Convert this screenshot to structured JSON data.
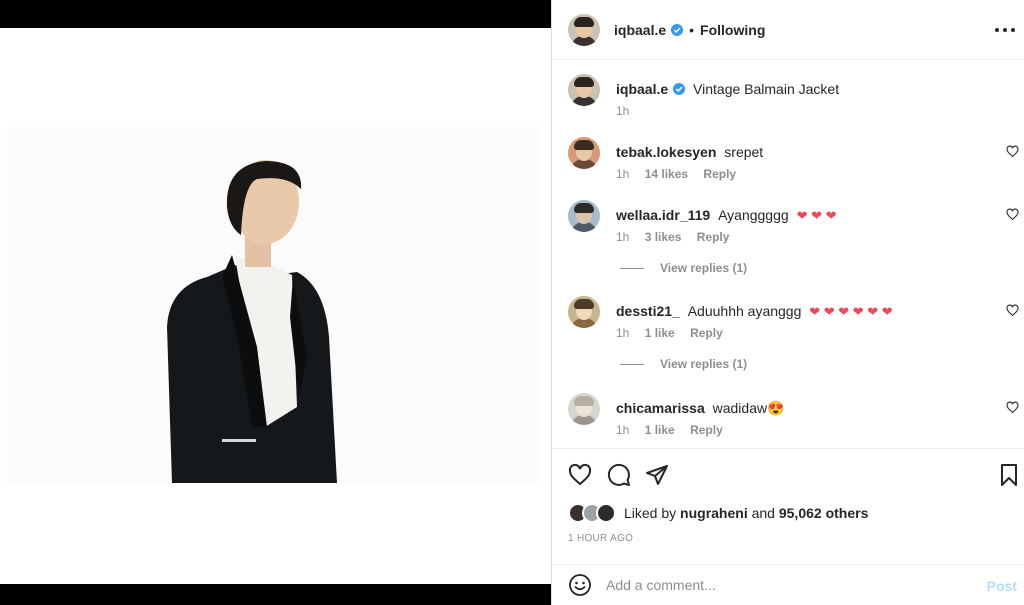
{
  "post": {
    "author": "iqbaal.e",
    "follow_state": "Following",
    "caption": "Vintage Balmain Jacket",
    "caption_time": "1h"
  },
  "comments": [
    {
      "user": "tebak.lokesyen",
      "text": "srepet",
      "time": "1h",
      "likes": "14 likes",
      "reply": "Reply",
      "view_replies": ""
    },
    {
      "user": "wellaa.idr_119",
      "text": "Ayanggggg",
      "hearts": 3,
      "time": "1h",
      "likes": "3 likes",
      "reply": "Reply",
      "view_replies": "View replies (1)"
    },
    {
      "user": "dessti21_",
      "text": "Aduuhhh ayanggg",
      "hearts": 6,
      "time": "1h",
      "likes": "1 like",
      "reply": "Reply",
      "view_replies": "View replies (1)"
    },
    {
      "user": "chicamarissa",
      "text": "wadidaw😍",
      "time": "1h",
      "likes": "1 like",
      "reply": "Reply",
      "view_replies": ""
    }
  ],
  "likes": {
    "prefix": "Liked by",
    "first_liker": "nugraheni",
    "conj": "and",
    "others": "95,062 others"
  },
  "timestamp": "1 HOUR AGO",
  "composer": {
    "placeholder": "Add a comment...",
    "post_label": "Post"
  },
  "icons": {
    "like": "heart-icon",
    "comment": "comment-bubble-icon",
    "share": "paper-plane-icon",
    "save": "bookmark-icon",
    "more": "more-dots-icon",
    "emoji": "emoji-face-icon",
    "verified": "verified-badge-icon"
  },
  "colors": {
    "verified": "#3897f0",
    "heart": "#ed4956",
    "post_disabled": "#b2dffc",
    "muted": "#8e8e8e"
  }
}
